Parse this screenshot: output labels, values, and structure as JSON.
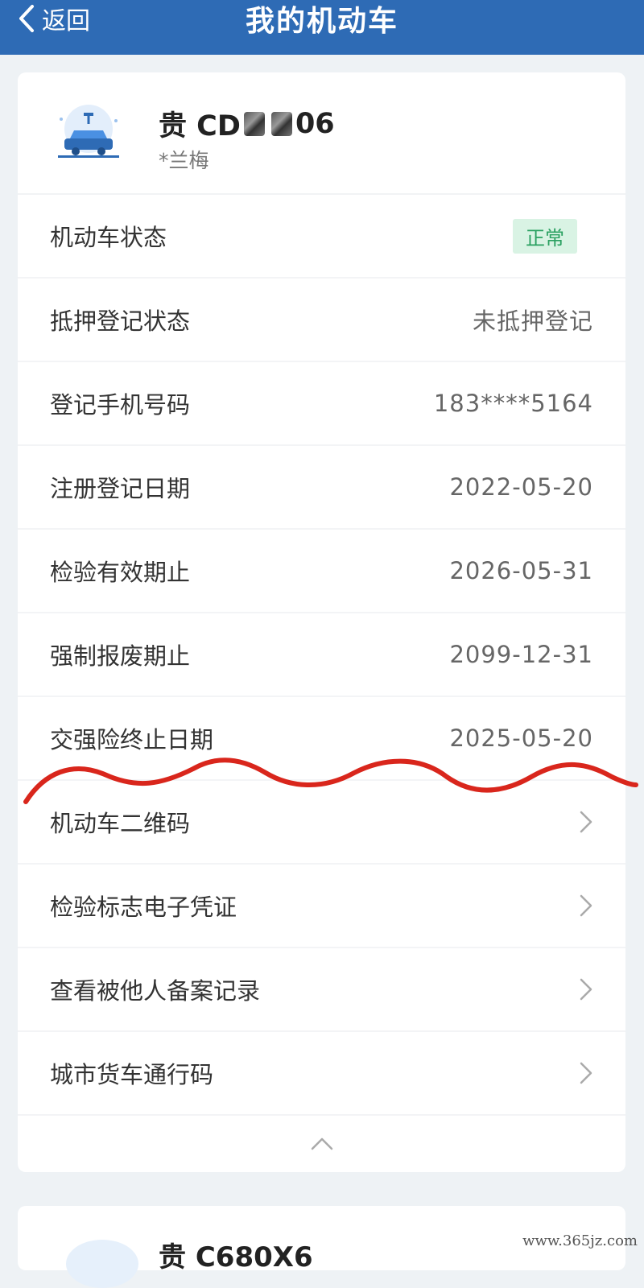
{
  "header": {
    "back_label": "返回",
    "title": "我的机动车"
  },
  "vehicle": {
    "plate_prefix": "贵 CD",
    "plate_suffix": "06",
    "owner": "*兰梅",
    "icon": "electric-car-icon"
  },
  "status_row": {
    "label": "机动车状态",
    "badge": "正常",
    "badge_color": "#2aa061"
  },
  "info_rows": [
    {
      "label": "抵押登记状态",
      "value": "未抵押登记"
    },
    {
      "label": "登记手机号码",
      "value": "183****5164"
    },
    {
      "label": "注册登记日期",
      "value": "2022-05-20"
    },
    {
      "label": "检验有效期止",
      "value": "2026-05-31"
    },
    {
      "label": "强制报废期止",
      "value": "2099-12-31"
    },
    {
      "label": "交强险终止日期",
      "value": "2025-05-20"
    }
  ],
  "nav_rows": [
    {
      "label": "机动车二维码"
    },
    {
      "label": "检验标志电子凭证"
    },
    {
      "label": "查看被他人备案记录"
    },
    {
      "label": "城市货车通行码"
    }
  ],
  "second_vehicle": {
    "plate": "贵 C680X6"
  },
  "colors": {
    "header_bg": "#2e6bb5",
    "annotation_red": "#d9261c"
  },
  "watermark": "www.365jz.com"
}
